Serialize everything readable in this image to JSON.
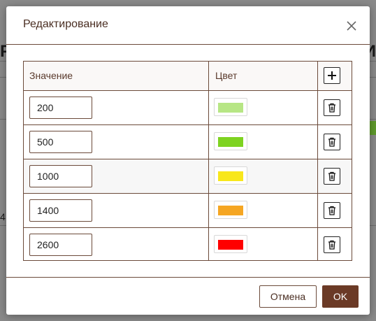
{
  "dialog": {
    "title": "Редактирование",
    "columns": {
      "value": "Значение",
      "color": "Цвет"
    },
    "rows": [
      {
        "value": "200",
        "color": "#b7e685"
      },
      {
        "value": "500",
        "color": "#7ed321"
      },
      {
        "value": "1000",
        "color": "#f8e71c"
      },
      {
        "value": "1400",
        "color": "#f5a623"
      },
      {
        "value": "2600",
        "color": "#ff0000"
      }
    ],
    "icons": {
      "close": "close-icon",
      "add": "plus-icon",
      "delete": "trash-icon"
    },
    "buttons": {
      "cancel": "Отмена",
      "ok": "OK"
    }
  },
  "background": {
    "visible_glyph_left": "Р",
    "visible_glyph_right": "И",
    "visible_number": "4"
  }
}
